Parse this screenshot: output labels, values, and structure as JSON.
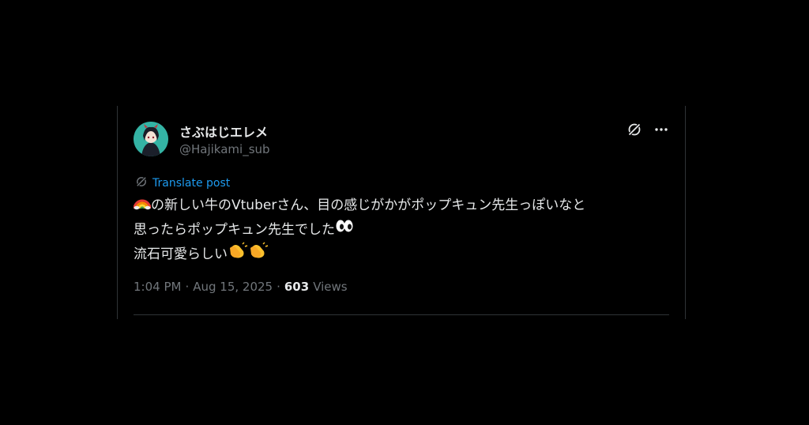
{
  "post": {
    "display_name": "さぶはじエレメ",
    "handle": "@Hajikami_sub",
    "translate_label": "Translate post",
    "body": {
      "line1_emoji": "rainbow-emoji",
      "line1_text": "の新しい牛のVtuberさん、目の感じがかがポップキュン先生っぽいなと",
      "line2_text": "思ったらポップキュン先生でした",
      "line2_emoji": "eyes-emoji",
      "line3_text": "流石可愛らしい",
      "line3_emoji": "clapping-hands-emoji"
    },
    "time": "1:04 PM",
    "date": "Aug 15, 2025",
    "separator": "·",
    "views_count": "603",
    "views_label": "Views"
  },
  "colors": {
    "background": "#000000",
    "text_primary": "#e7e9ea",
    "text_secondary": "#71767b",
    "link": "#1d9bf0",
    "border": "#2f3336"
  },
  "icons": {
    "grok": "grok-icon",
    "more": "more-icon",
    "translate": "translate-icon"
  }
}
